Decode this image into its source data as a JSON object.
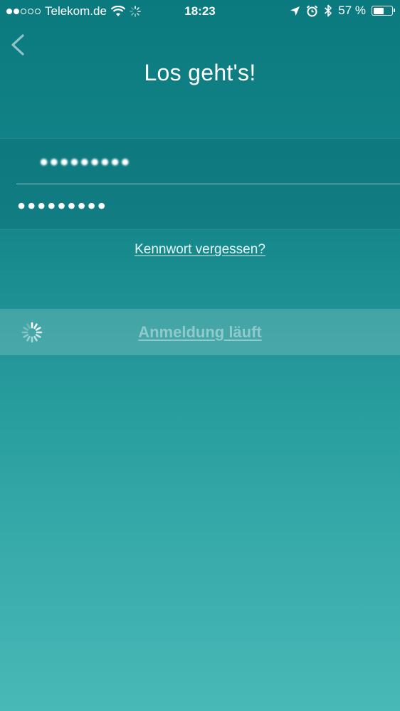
{
  "status_bar": {
    "carrier": "Telekom.de",
    "time": "18:23",
    "battery_percent": "57 %",
    "battery_level": 0.57,
    "signal_strength": 2,
    "signal_max": 5,
    "icons": [
      "wifi-icon",
      "activity-spinner-icon",
      "location-arrow-icon",
      "alarm-icon",
      "bluetooth-icon",
      "battery-icon"
    ]
  },
  "header": {
    "back_icon": "chevron-left-icon",
    "title": "Los geht's!"
  },
  "form": {
    "email_value": "●●●●●●●●●",
    "password_value": "●●●●●●●●●"
  },
  "links": {
    "forgot_password": "Kennwort vergessen?"
  },
  "login": {
    "label": "Anmeldung läuft",
    "spinner_icon": "loading-spinner-icon"
  },
  "colors": {
    "background_top": "#0b7a7f",
    "background_bottom": "#49b9b7",
    "text": "#ffffff"
  }
}
